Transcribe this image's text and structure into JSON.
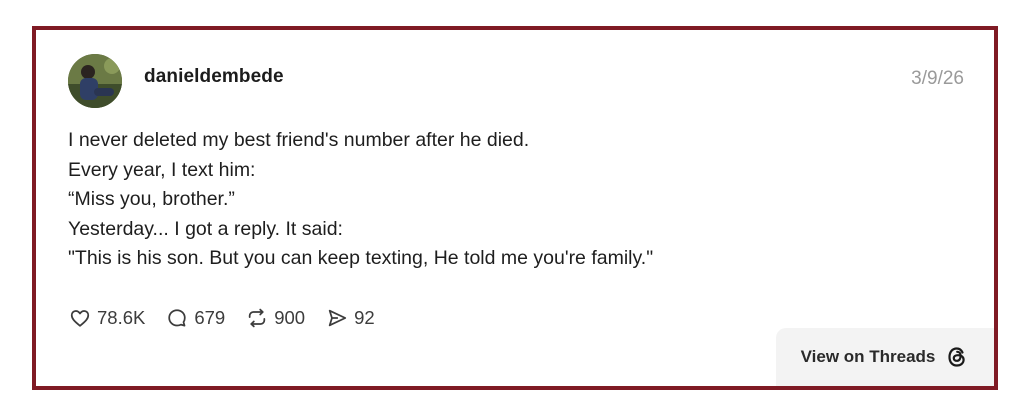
{
  "post": {
    "username": "danieldembede",
    "date": "3/9/26",
    "lines": [
      "I never deleted my best friend's number after he died.",
      "Every year, I text him:",
      "“Miss you, brother.”",
      "Yesterday... I got a reply. It said:",
      "\"This is his son. But you can keep texting, He told me you're family.\""
    ]
  },
  "actions": {
    "likes": "78.6K",
    "comments": "679",
    "reposts": "900",
    "shares": "92"
  },
  "view_button": {
    "label": "View on Threads"
  },
  "icons": {
    "like": "heart-icon",
    "comment": "comment-bubble-icon",
    "repost": "repost-arrows-icon",
    "share": "send-arrow-icon",
    "brand": "threads-logo-icon"
  },
  "colors": {
    "card_border": "#7f1a24",
    "text": "#1e1e1e",
    "muted": "#9a9a9a",
    "button_bg": "#f3f3f3"
  }
}
